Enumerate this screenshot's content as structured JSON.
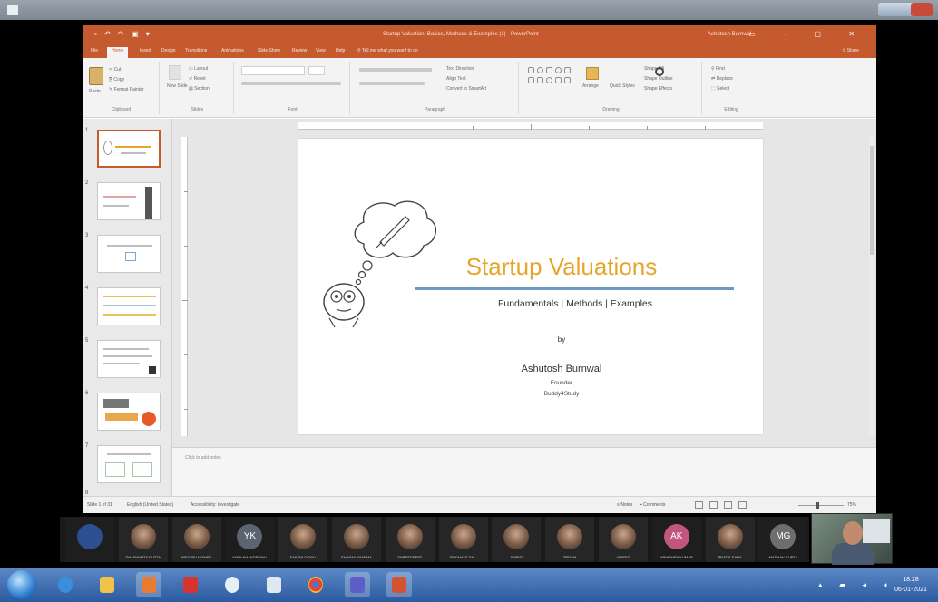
{
  "powerpoint": {
    "window_title": "Startup Valuation: Basics, Methods & Examples (1) - PowerPoint",
    "user_name": "Ashutosh Burnwal",
    "tabs": [
      "File",
      "Home",
      "Insert",
      "Design",
      "Transitions",
      "Animations",
      "Slide Show",
      "Review",
      "View",
      "Help"
    ],
    "tell_me": "Tell me what you want to do",
    "share": "Share",
    "ribbon": {
      "clipboard": {
        "paste": "Paste",
        "cut": "Cut",
        "copy": "Copy",
        "format_painter": "Format Painter",
        "label": "Clipboard"
      },
      "slides": {
        "new_slide": "New Slide",
        "layout": "Layout",
        "reset": "Reset",
        "section": "Section",
        "label": "Slides"
      },
      "font_label": "Font",
      "paragraph": {
        "text_direction": "Text Direction",
        "align_text": "Align Text",
        "convert_smartart": "Convert to SmartArt",
        "label": "Paragraph"
      },
      "drawing": {
        "arrange": "Arrange",
        "quick_styles": "Quick Styles",
        "shape_fill": "Shape Fill",
        "shape_outline": "Shape Outline",
        "shape_effects": "Shape Effects",
        "label": "Drawing"
      },
      "editing": {
        "find": "Find",
        "replace": "Replace",
        "select": "Select",
        "label": "Editing"
      }
    },
    "thumbnails": [
      "1",
      "2",
      "3",
      "4",
      "5",
      "6",
      "7",
      "8"
    ],
    "slide": {
      "title": "Startup Valuations",
      "subtitle": "Fundamentals | Methods | Examples",
      "by": "by",
      "author": "Ashutosh Burnwal",
      "role": "Founder",
      "org": "Buddy4Study"
    },
    "notes_placeholder": "Click to add notes",
    "status": {
      "slide_count": "Slide 1 of 31",
      "language": "English (United States)",
      "accessibility": "Accessibility: Investigate",
      "notes": "Notes",
      "comments": "Comments",
      "zoom": "75%"
    }
  },
  "participants": [
    {
      "initials": "",
      "name": "",
      "color": "#2d4f8f",
      "kind": "initials"
    },
    {
      "initials": "",
      "name": "SHASHWATA DUTTA",
      "kind": "photo"
    },
    {
      "initials": "",
      "name": "APOORV MISHRA",
      "kind": "photo"
    },
    {
      "initials": "YK",
      "name": "YASH KHANDELWAL",
      "color": "#5b6470",
      "kind": "initials"
    },
    {
      "initials": "",
      "name": "SAKSHI GOYAL",
      "kind": "photo"
    },
    {
      "initials": "",
      "name": "SHIVANI SHARMA",
      "kind": "photo"
    },
    {
      "initials": "",
      "name": "SHREEDEEPT",
      "kind": "photo"
    },
    {
      "initials": "",
      "name": "SIDDHANT SA...",
      "kind": "photo"
    },
    {
      "initials": "",
      "name": "SMRITI",
      "kind": "photo"
    },
    {
      "initials": "",
      "name": "TRISHA",
      "kind": "photo"
    },
    {
      "initials": "",
      "name": "VINEET",
      "kind": "photo"
    },
    {
      "initials": "AK",
      "name": "ABHISHEK KUMAR",
      "color": "#c2567e",
      "kind": "initials"
    },
    {
      "initials": "",
      "name": "PRATIK SAHA",
      "kind": "photo"
    },
    {
      "initials": "MG",
      "name": "MADHAV GUPTA",
      "color": "#6e6e6e",
      "kind": "initials"
    }
  ],
  "taskbar": {
    "time": "18:28",
    "date": "06-01-2021"
  }
}
